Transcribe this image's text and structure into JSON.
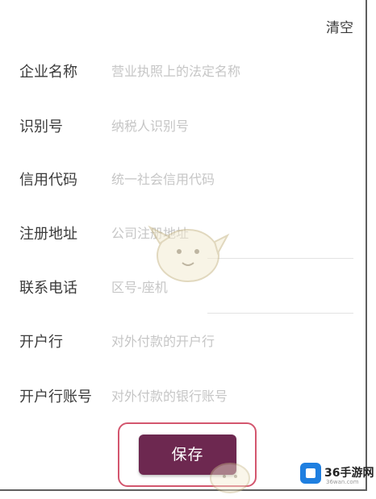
{
  "header": {
    "clear_label": "清空"
  },
  "form": {
    "rows": [
      {
        "label": "企业名称",
        "placeholder": "营业执照上的法定名称"
      },
      {
        "label": "识别号",
        "placeholder": "纳税人识别号"
      },
      {
        "label": "信用代码",
        "placeholder": "统一社会信用代码"
      },
      {
        "label": "注册地址",
        "placeholder": "公司注册地址"
      },
      {
        "label": "联系电话",
        "placeholder": "区号-座机"
      },
      {
        "label": "开户行",
        "placeholder": "对外付款的开户行"
      },
      {
        "label": "开户行账号",
        "placeholder": "对外付款的银行账号"
      }
    ]
  },
  "footer": {
    "save_label": "保存"
  },
  "watermark": {
    "brand": "36手游网",
    "url": "36wan.com"
  },
  "colors": {
    "accent": "#6d2850",
    "highlight_border": "#d3566e",
    "label_text": "#3b3b3b",
    "placeholder_text": "#c6c6c6"
  }
}
